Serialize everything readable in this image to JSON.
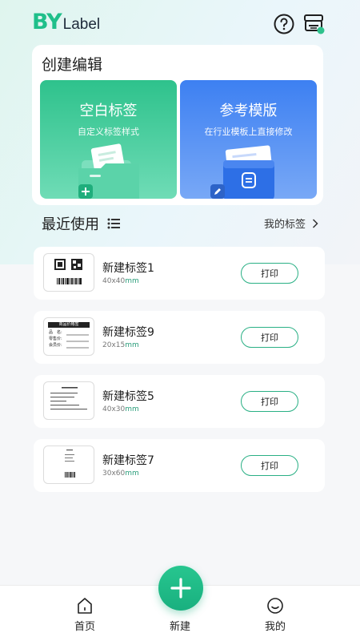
{
  "app": {
    "logo_by": "BY",
    "logo_label": "Label"
  },
  "create": {
    "title": "创建编辑",
    "blank": {
      "title": "空白标签",
      "subtitle": "自定义标签样式"
    },
    "template": {
      "title": "参考模版",
      "subtitle": "在行业模板上直接修改"
    }
  },
  "recent": {
    "title": "最近使用",
    "my_labels": "我的标签"
  },
  "cards": [
    {
      "name": "新建标签1",
      "size": "40x40",
      "unit": "mm",
      "print": "打印"
    },
    {
      "name": "新建标签9",
      "size": "20x15",
      "unit": "mm",
      "print": "打印"
    },
    {
      "name": "新建标签5",
      "size": "40x30",
      "unit": "mm",
      "print": "打印"
    },
    {
      "name": "新建标签7",
      "size": "30x60",
      "unit": "mm",
      "print": "打印"
    }
  ],
  "thumbs": {
    "price_tag": {
      "header": "商品价格签",
      "rows": [
        "品　名:",
        "零售价:",
        "会员价:"
      ]
    }
  },
  "nav": {
    "home": "首页",
    "new": "新建",
    "mine": "我的"
  },
  "colors": {
    "accent": "#1fbf8a",
    "blue": "#3d80f2",
    "text": "#1e1e1e"
  }
}
